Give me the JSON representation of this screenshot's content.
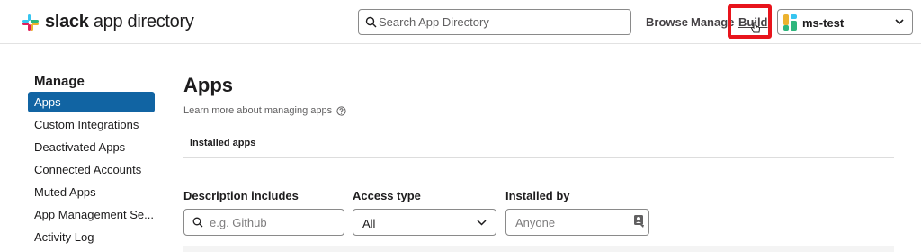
{
  "header": {
    "logo_brand": "slack",
    "logo_suffix": " app directory",
    "search": {
      "placeholder": "Search App Directory",
      "icon": "search-icon"
    },
    "nav": {
      "browse": "Browse",
      "manage": "Manage",
      "build": "Build"
    },
    "workspace": {
      "name": "ms-test",
      "icon": "workspace-icon"
    },
    "colors": {
      "highlight": "#e8141c"
    }
  },
  "sidebar": {
    "title": "Manage",
    "items": [
      {
        "label": "Apps",
        "active": true
      },
      {
        "label": "Custom Integrations"
      },
      {
        "label": "Deactivated Apps"
      },
      {
        "label": "Connected Accounts"
      },
      {
        "label": "Muted Apps"
      },
      {
        "label": "App Management Se..."
      },
      {
        "label": "Activity Log"
      }
    ],
    "active_color": "#1164a3"
  },
  "main": {
    "title": "Apps",
    "learn_more": "Learn more about managing apps",
    "tabs": [
      {
        "label": "Installed apps",
        "active": true
      }
    ],
    "filters": {
      "description": {
        "label": "Description includes",
        "placeholder": "e.g. Github"
      },
      "access": {
        "label": "Access type",
        "value": "All"
      },
      "installed_by": {
        "label": "Installed by",
        "placeholder": "Anyone"
      }
    }
  }
}
